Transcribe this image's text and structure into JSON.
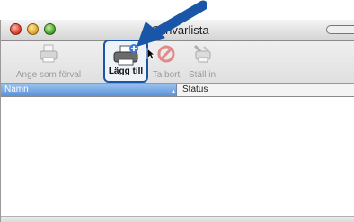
{
  "window": {
    "title": "Skrivarlista"
  },
  "toolbar": {
    "items": [
      {
        "label": "Ange som förval",
        "icon": "printer-icon",
        "enabled": false
      },
      {
        "label": "Lägg till",
        "icon": "printer-add-icon",
        "enabled": true
      },
      {
        "label": "Ta bort",
        "icon": "delete-icon",
        "enabled": false
      },
      {
        "label": "Ställ in",
        "icon": "config-icon",
        "enabled": false
      }
    ]
  },
  "table": {
    "columns": [
      "Namn",
      "Status"
    ],
    "sort_indicator": "▲",
    "rows": []
  },
  "colors": {
    "highlight": "#1a56a8",
    "header_selected": "#6ea0dc"
  }
}
